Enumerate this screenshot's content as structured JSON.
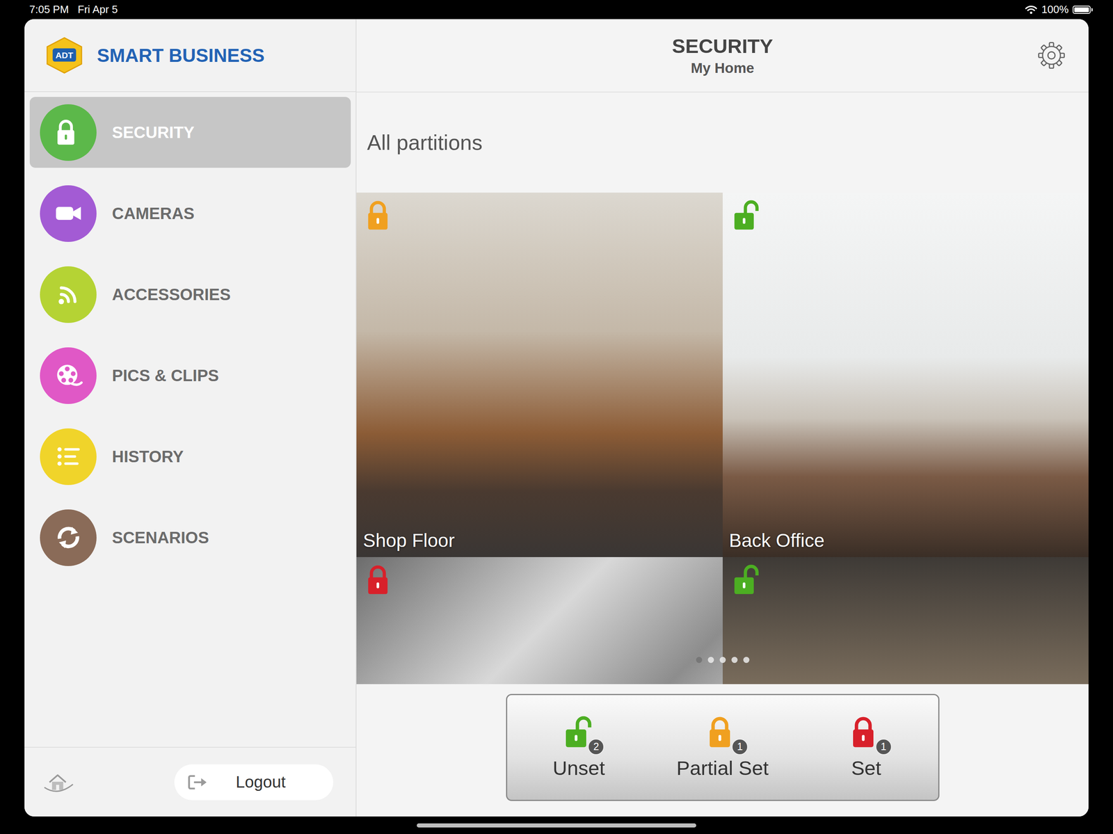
{
  "status_bar": {
    "time": "7:05 PM",
    "date": "Fri Apr 5",
    "battery": "100%",
    "battery_level": 1
  },
  "logo": {
    "badge": "ADT",
    "text": "SMART BUSINESS"
  },
  "sidebar": {
    "items": [
      {
        "label": "SECURITY",
        "selected": true,
        "color": "#5cb84a"
      },
      {
        "label": "CAMERAS",
        "selected": false,
        "color": "#a35bd4"
      },
      {
        "label": "ACCESSORIES",
        "selected": false,
        "color": "#b5d334"
      },
      {
        "label": "PICS & CLIPS",
        "selected": false,
        "color": "#e058c6"
      },
      {
        "label": "HISTORY",
        "selected": false,
        "color": "#f0d42a"
      },
      {
        "label": "SCENARIOS",
        "selected": false,
        "color": "#8a6b58"
      }
    ],
    "logout": "Logout"
  },
  "header": {
    "title": "SECURITY",
    "subtitle": "My Home"
  },
  "section_title": "All partitions",
  "partitions": [
    {
      "name": "Shop Floor",
      "locked": true,
      "color": "#f0a020"
    },
    {
      "name": "Back Office",
      "locked": false,
      "color": "#4cae22"
    },
    {
      "locked": true,
      "color": "#d8202a"
    },
    {
      "locked": false,
      "color": "#4cae22"
    }
  ],
  "pager": {
    "pages": [
      {
        "selected": true
      },
      {
        "selected": false
      },
      {
        "selected": false
      },
      {
        "selected": false
      },
      {
        "selected": false
      }
    ]
  },
  "actions": [
    {
      "label": "Unset",
      "count": "2",
      "locked": false,
      "color": "#4cae22"
    },
    {
      "label": "Partial Set",
      "count": "1",
      "locked": true,
      "color": "#f0a020"
    },
    {
      "label": "Set",
      "count": "1",
      "locked": true,
      "color": "#d8202a"
    }
  ]
}
